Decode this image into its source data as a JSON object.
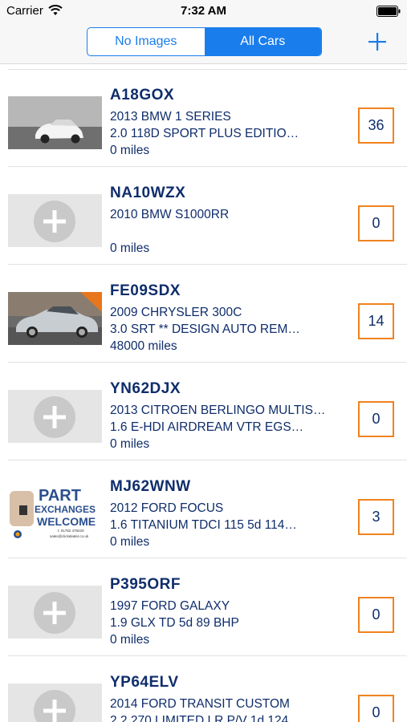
{
  "status_bar": {
    "carrier": "Carrier",
    "time": "7:32 AM"
  },
  "nav": {
    "segments": [
      {
        "label": "No Images",
        "selected": false
      },
      {
        "label": "All Cars",
        "selected": true
      }
    ],
    "add_icon": "plus-icon",
    "accent_color": "#1a7dec"
  },
  "cars": [
    {
      "reg": "A18GOX",
      "line1": "2013 BMW 1 SERIES",
      "line2": "2.0 118D SPORT PLUS EDITIO…",
      "miles": "0 miles",
      "count": "36",
      "image": "photo-white-bmw"
    },
    {
      "reg": "NA10WZX",
      "line1": "2010 BMW S1000RR",
      "line2": "",
      "miles": "0 miles",
      "count": "0",
      "image": "placeholder-plus"
    },
    {
      "reg": "FE09SDX",
      "line1": "2009 CHRYSLER 300C",
      "line2": "3.0 SRT **  DESIGN AUTO REM…",
      "miles": "48000 miles",
      "count": "14",
      "image": "photo-silver-chrysler"
    },
    {
      "reg": "YN62DJX",
      "line1": "2013 CITROEN BERLINGO MULTIS…",
      "line2": "1.6 E-HDI AIRDREAM VTR EGS…",
      "miles": "0 miles",
      "count": "0",
      "image": "placeholder-plus"
    },
    {
      "reg": "MJ62WNW",
      "line1": "2012 FORD FOCUS",
      "line2": "1.6 TITANIUM TDCI 115 5d 114…",
      "miles": "0 miles",
      "count": "3",
      "image": "part-exchange-banner"
    },
    {
      "reg": "P395ORF",
      "line1": "1997 FORD GALAXY",
      "line2": "1.9 GLX TD 5d 89 BHP",
      "miles": "0 miles",
      "count": "0",
      "image": "placeholder-plus"
    },
    {
      "reg": "YP64ELV",
      "line1": "2014 FORD TRANSIT CUSTOM",
      "line2": "2.2 270 LIMITED LR P/V 1d 124…",
      "miles": "",
      "count": "0",
      "image": "placeholder-plus"
    }
  ],
  "part_exchange": {
    "line_a": "PART",
    "line_b": "EXCHANGES",
    "line_c": "WELCOME",
    "phone": "t: 01782 478220",
    "email": "sales@clickdealer.co.uk"
  },
  "colors": {
    "count_border": "#f0821e",
    "text_navy": "#0f2d6b"
  }
}
